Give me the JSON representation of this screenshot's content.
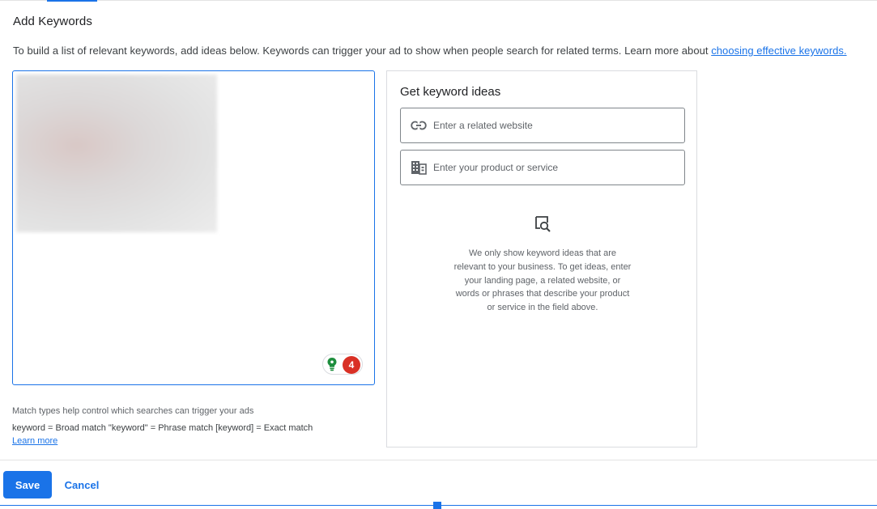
{
  "section": {
    "title": "Add Keywords",
    "intro_text": "To build a list of relevant keywords, add ideas below. Keywords can trigger your ad to show when people search for related terms. Learn more about ",
    "intro_link": "choosing effective keywords."
  },
  "keyword_editor": {
    "value": "",
    "assist_icon": "lightbulb-icon",
    "badge_count": "4"
  },
  "match_types": {
    "help": "Match types help control which searches can trigger your ads",
    "legend": "keyword = Broad match  \"keyword\" = Phrase match  [keyword] = Exact match",
    "learn_more": "Learn more"
  },
  "ideas": {
    "title": "Get keyword ideas",
    "website_placeholder": "Enter a related website",
    "website_icon": "link-icon",
    "product_placeholder": "Enter your product or service",
    "product_icon": "building-icon",
    "empty_icon": "search-document-icon",
    "empty_note": "We only show keyword ideas that are relevant to your business. To get ideas, enter your landing page, a related website, or words or phrases that describe your product or service in the field above."
  },
  "footer": {
    "save_label": "Save",
    "cancel_label": "Cancel"
  },
  "colors": {
    "accent": "#1a73e8",
    "badge": "#d93025",
    "bulb": "#1e8e3e"
  }
}
